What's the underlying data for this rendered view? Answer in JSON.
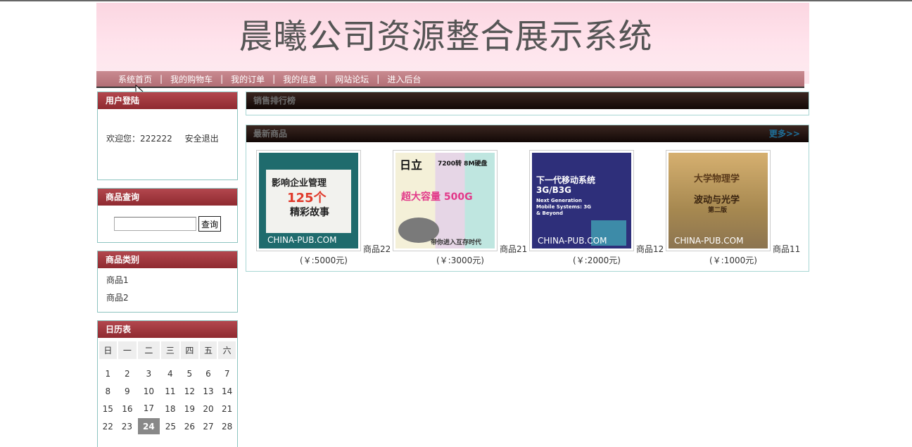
{
  "banner": {
    "title": "晨曦公司资源整合展示系统"
  },
  "nav": {
    "items": [
      {
        "label": "系统首页"
      },
      {
        "label": "我的购物车"
      },
      {
        "label": "我的订单"
      },
      {
        "label": "我的信息"
      },
      {
        "label": "网站论坛"
      },
      {
        "label": "进入后台"
      }
    ],
    "separator": "|"
  },
  "login": {
    "title": "用户登陆",
    "welcome": "欢迎您：222222",
    "logout": "安全退出"
  },
  "search": {
    "title": "商品查询",
    "value": "",
    "button": "查询"
  },
  "categories": {
    "title": "商品类别",
    "items": [
      "商品1",
      "商品2"
    ]
  },
  "calendar": {
    "title": "日历表",
    "weekdays": [
      "日",
      "一",
      "二",
      "三",
      "四",
      "五",
      "六"
    ],
    "weeks": [
      [
        "1",
        "2",
        "3",
        "4",
        "5",
        "6",
        "7"
      ],
      [
        "8",
        "9",
        "10",
        "11",
        "12",
        "13",
        "14"
      ],
      [
        "15",
        "16",
        "17",
        "18",
        "19",
        "20",
        "21"
      ],
      [
        "22",
        "23",
        "24",
        "25",
        "26",
        "27",
        "28"
      ]
    ],
    "today": "24"
  },
  "ranking": {
    "title": "销售排行榜"
  },
  "latest": {
    "title": "最新商品",
    "more": "更多>>",
    "products": [
      {
        "name": "商品22",
        "price": "(￥:5000元)",
        "cover": {
          "bg": "#1f6b6d",
          "l1": "影响企业管理",
          "l2": "125个",
          "l3": "精彩故事",
          "foot": "CHINA-PUB.COM"
        }
      },
      {
        "name": "商品21",
        "price": "(￥:3000元)",
        "cover": {
          "bg": "#e8e0e6",
          "l1": "日立",
          "l2": "7200转 8M硬盘",
          "l3": "超大容量 500G",
          "foot": "带你进入互存时代"
        }
      },
      {
        "name": "商品12",
        "price": "(￥:2000元)",
        "cover": {
          "bg": "#2e2f7a",
          "l1": "下一代移动系统",
          "l2": "3G/B3G",
          "l3": "Next Generation Mobile Systems: 3G & Beyond",
          "foot": "CHINA-PUB.COM"
        }
      },
      {
        "name": "商品11",
        "price": "(￥:1000元)",
        "cover": {
          "bg": "#b7925a",
          "l1": "大学物理学",
          "l2": "波动与光学",
          "l3": "第二版",
          "foot": "CHINA-PUB.COM"
        }
      }
    ]
  }
}
